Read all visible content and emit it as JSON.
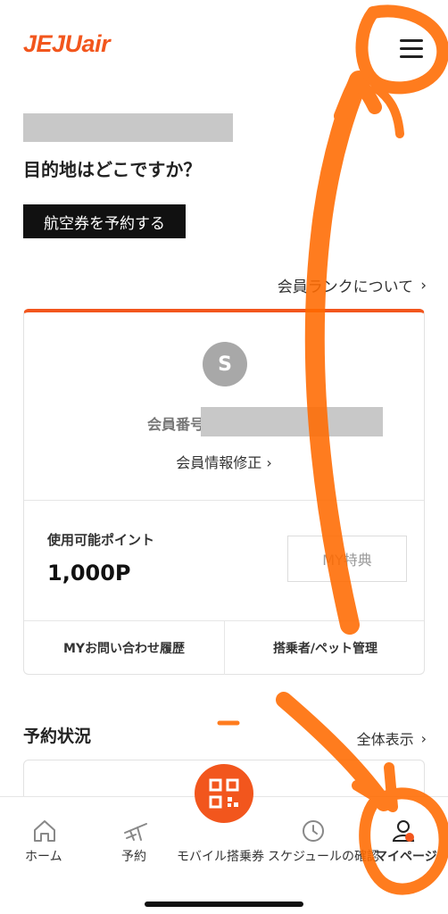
{
  "header": {
    "logo_main": "JEJU",
    "logo_suffix": "air",
    "menu_icon": "hamburger-menu-icon"
  },
  "hero": {
    "question": "目的地はどこですか？",
    "book_button": "航空券を予約する"
  },
  "rank_link": {
    "label": "会員ランクについて",
    "chevron": "›"
  },
  "member_card": {
    "avatar_letter": "S",
    "member_number_label": "会員番号",
    "edit_link": "会員情報修正 ›",
    "points_label": "使用可能ポイント",
    "points_value": "1,000P",
    "benefits_button": "MY特典",
    "inquiry_history": "MYお問い合わせ履歴",
    "passenger_management": "搭乗者/ペット管理",
    "accent_color": "#f2561d"
  },
  "reservations": {
    "title": "予約状況",
    "view_all": "全体表示",
    "chevron": "›"
  },
  "tabbar": {
    "items": [
      {
        "label": "ホーム",
        "icon": "home-icon"
      },
      {
        "label": "予約",
        "icon": "plane-icon"
      },
      {
        "label": "モバイル搭乗券",
        "icon": "qr-code-icon"
      },
      {
        "label": "スケジュールの確認",
        "icon": "clock-icon"
      },
      {
        "label": "マイページ",
        "icon": "person-icon"
      }
    ]
  },
  "colors": {
    "brand": "#f2561d",
    "annotation_marker": "#ff6a00"
  }
}
